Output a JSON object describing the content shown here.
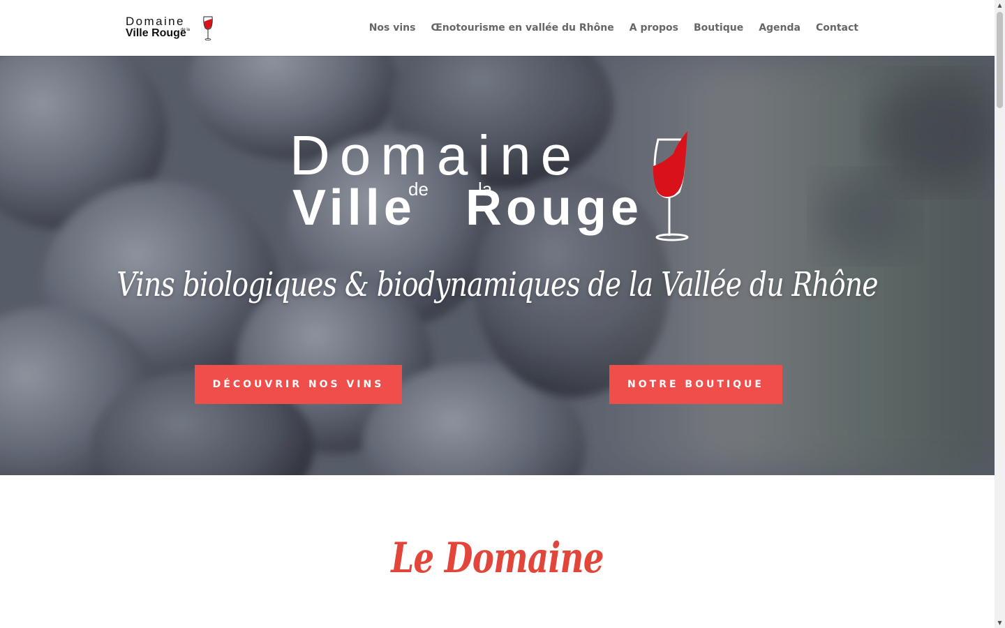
{
  "header": {
    "logo": {
      "line1": "Domaine",
      "line_small": "de la",
      "line2": "Ville Rouge"
    },
    "nav": [
      "Nos vins",
      "Œnotourisme en vallée du Rhône",
      "A propos",
      "Boutique",
      "Agenda",
      "Contact"
    ]
  },
  "hero": {
    "logo": {
      "line1": "Domaine",
      "line_de": "de",
      "line_la": "la",
      "line2_a": "Ville",
      "line2_b": "Rouge"
    },
    "tagline": "Vins biologiques & biodynamiques de la Vallée du Rhône",
    "buttons": {
      "wines": "Découvrir nos vins",
      "shop": "Notre boutique"
    }
  },
  "section": {
    "title": "Le Domaine"
  },
  "scrollbar": {
    "up": "▲",
    "down": "▼"
  },
  "colors": {
    "accent": "#f04e4b",
    "title_red": "#e2463b",
    "nav_text": "#666666",
    "wine": "#d9111b"
  }
}
